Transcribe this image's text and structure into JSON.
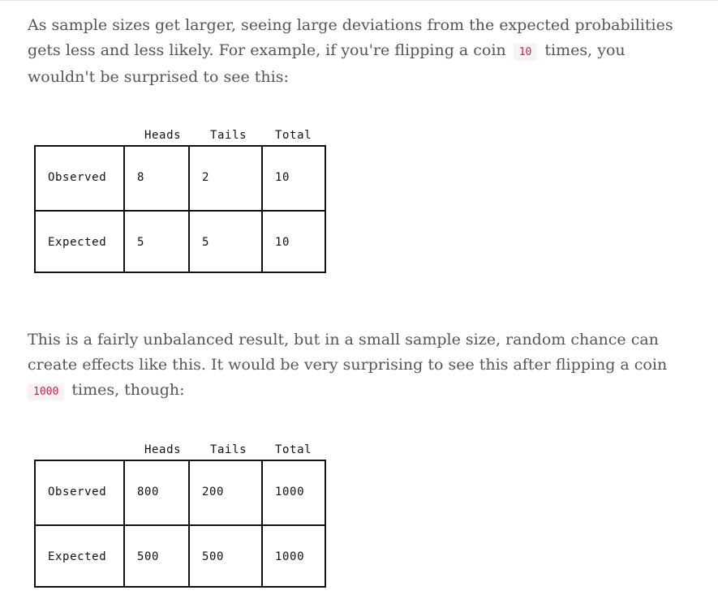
{
  "paragraphs": {
    "p1": {
      "line1": "As sample sizes get larger, seeing large deviations from the expected probabilities",
      "line2_before": "gets less and less likely. For example, if you're flipping a coin",
      "line2_code": "10",
      "line2_after": "times, you",
      "line3": "wouldn't be surprised to see this:"
    },
    "p2": {
      "line1": "This is a fairly unbalanced result, but in a small sample size, random chance can",
      "line2": "create effects like this. It would be very surprising to see this after flipping a coin",
      "line3_code": "1000",
      "line3_after": "times, though:"
    }
  },
  "tables": {
    "small": {
      "headers": [
        "Heads",
        "Tails",
        "Total"
      ],
      "rows": [
        {
          "label": "Observed",
          "heads": "8",
          "tails": "2",
          "total": "10"
        },
        {
          "label": "Expected",
          "heads": "5",
          "tails": "5",
          "total": "10"
        }
      ]
    },
    "large": {
      "headers": [
        "Heads",
        "Tails",
        "Total"
      ],
      "rows": [
        {
          "label": "Observed",
          "heads": "800",
          "tails": "200",
          "total": "1000"
        },
        {
          "label": "Expected",
          "heads": "500",
          "tails": "500",
          "total": "1000"
        }
      ]
    }
  },
  "colors": {
    "text": "#555555",
    "code_text": "#c7254e",
    "code_bg": "#f9f2f4",
    "table_border": "#111111"
  }
}
